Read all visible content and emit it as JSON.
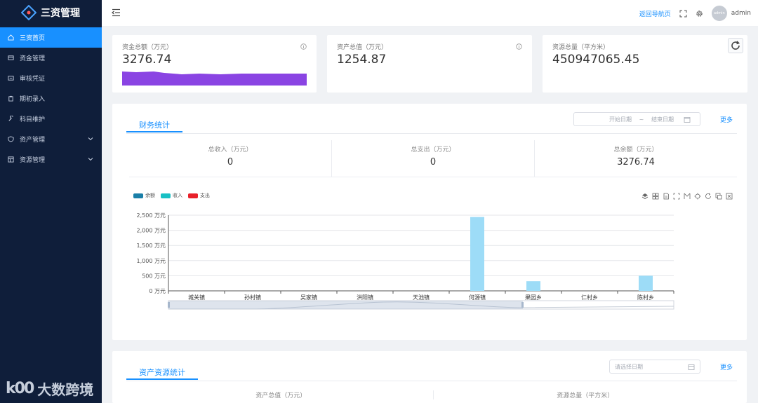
{
  "app": {
    "title": "三资管理"
  },
  "sidebar": {
    "items": [
      {
        "label": "三资首页",
        "icon": "home-icon",
        "active": true
      },
      {
        "label": "资金管理",
        "icon": "wallet-icon"
      },
      {
        "label": "审核凭证",
        "icon": "document-icon"
      },
      {
        "label": "期初录入",
        "icon": "clipboard-icon"
      },
      {
        "label": "科目维护",
        "icon": "wrench-icon"
      },
      {
        "label": "资产管理",
        "icon": "shield-icon",
        "expandable": true
      },
      {
        "label": "资源管理",
        "icon": "database-icon",
        "expandable": true
      }
    ]
  },
  "watermark": {
    "logo": "k00",
    "text": "大数跨境"
  },
  "header": {
    "nav_link": "返回导航页",
    "avatar_text": "admin",
    "username": "admin"
  },
  "stats": [
    {
      "label": "资金总额（万元）",
      "value": "3276.74"
    },
    {
      "label": "资产总值（万元）",
      "value": "1254.87"
    },
    {
      "label": "资源总量（平方米）",
      "value": "450947065.45"
    }
  ],
  "finance": {
    "tab": "财务统计",
    "start_placeholder": "开始日期",
    "separator": "~",
    "end_placeholder": "结束日期",
    "more": "更多",
    "summary": [
      {
        "label": "总收入（万元）",
        "value": "0"
      },
      {
        "label": "总支出（万元）",
        "value": "0"
      },
      {
        "label": "总余额（万元）",
        "value": "3276.74"
      }
    ]
  },
  "chart_data": {
    "type": "bar",
    "categories": [
      "城关镇",
      "孙村镇",
      "吴家镇",
      "洪阳镇",
      "天池镇",
      "何源镇",
      "果园乡",
      "仁村乡",
      "陈村乡"
    ],
    "series": [
      {
        "name": "余额",
        "color": "#1a7fa8",
        "values": [
          0,
          0,
          0,
          0,
          0,
          2440,
          320,
          0,
          500
        ]
      },
      {
        "name": "收入",
        "color": "#18c0c4",
        "values": [
          0,
          0,
          0,
          0,
          0,
          0,
          0,
          0,
          0
        ]
      },
      {
        "name": "支出",
        "color": "#e8202a",
        "values": [
          0,
          0,
          0,
          0,
          0,
          0,
          0,
          0,
          0
        ]
      }
    ],
    "bar_color": "#9ddcf7",
    "yticks": [
      "0 万元",
      "500 万元",
      "1,000 万元",
      "1,500 万元",
      "2,000 万元",
      "2,500 万元"
    ],
    "ylim": [
      0,
      2500
    ],
    "grid": true,
    "legend": "top-left",
    "datazoom": true
  },
  "assets": {
    "tab": "资产资源统计",
    "date_placeholder": "请选择日期",
    "more": "更多",
    "summary": [
      {
        "label": "资产总值（万元）"
      },
      {
        "label": "资源总量（平方米）"
      }
    ]
  }
}
